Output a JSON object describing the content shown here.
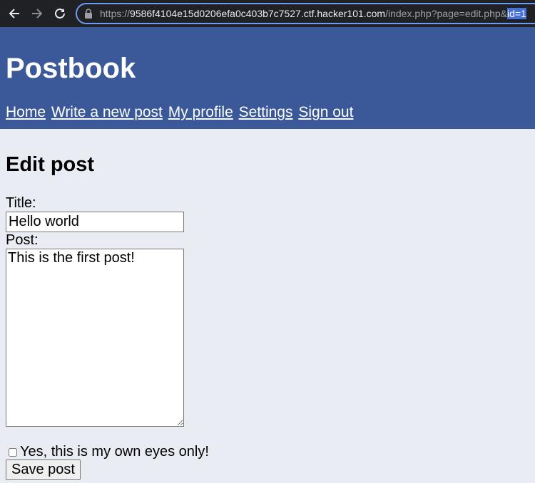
{
  "browser": {
    "url_scheme": "https://",
    "url_host": "9586f4104e15d0206efa0c403b7c7527.ctf.hacker101.com",
    "url_path": "/index.php?page=edit.php&",
    "url_selected": "id=1",
    "icons": [
      "back-arrow-icon",
      "forward-arrow-icon",
      "reload-icon",
      "lock-icon"
    ]
  },
  "header": {
    "title": "Postbook",
    "nav": [
      {
        "label": "Home"
      },
      {
        "label": "Write a new post"
      },
      {
        "label": "My profile"
      },
      {
        "label": "Settings"
      },
      {
        "label": "Sign out"
      }
    ]
  },
  "form": {
    "heading": "Edit post",
    "title_label": "Title:",
    "title_value": "Hello world",
    "post_label": "Post:",
    "post_value": "This is the first post!",
    "private_label": "Yes, this is my own eyes only!",
    "private_checked": false,
    "save_label": "Save post"
  },
  "colors": {
    "header_bg": "#3b5999",
    "page_bg": "#e9edf3",
    "browser_bg": "#202124",
    "url_highlight": "#4470d9"
  }
}
